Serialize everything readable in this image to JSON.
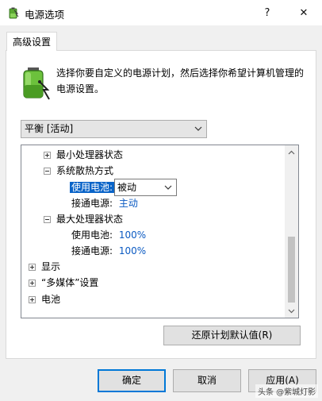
{
  "window": {
    "title": "电源选项",
    "help_label": "?",
    "close_label": "✕"
  },
  "tab": {
    "label": "高级设置"
  },
  "description": "选择你要自定义的电源计划，然后选择你希望计算机管理的电源设置。",
  "plan_select": {
    "value": "平衡 [活动]"
  },
  "tree": {
    "items": [
      {
        "label": "最小处理器状态",
        "expanded": false
      },
      {
        "label": "系统散热方式",
        "expanded": true
      },
      {
        "label": "使用电池:",
        "value": "被动",
        "selected": true
      },
      {
        "label": "接通电源:",
        "value": "主动"
      },
      {
        "label": "最大处理器状态",
        "expanded": true
      },
      {
        "label": "使用电池:",
        "value": "100%"
      },
      {
        "label": "接通电源:",
        "value": "100%"
      },
      {
        "label": "显示",
        "expanded": false
      },
      {
        "label": "“多媒体”设置",
        "expanded": false
      },
      {
        "label": "电池",
        "expanded": false
      }
    ]
  },
  "restore_button": "还原计划默认值(R)",
  "buttons": {
    "ok": "确定",
    "cancel": "取消",
    "apply": "应用(A)"
  },
  "watermark": "头条 @紫城灯影",
  "colors": {
    "selection": "#0a64c8",
    "link_value": "#0b5ac2",
    "focus_border": "#0078d7"
  }
}
